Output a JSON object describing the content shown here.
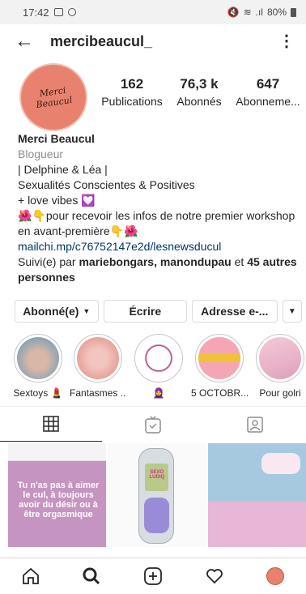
{
  "status_bar": {
    "time": "17:42",
    "battery": "80%"
  },
  "header": {
    "username": "mercibeaucul_"
  },
  "avatar": {
    "logo_text": "Merci Beaucul"
  },
  "stats": [
    {
      "value": "162",
      "label": "Publications"
    },
    {
      "value": "76,3 k",
      "label": "Abonnés"
    },
    {
      "value": "647",
      "label": "Abonneme..."
    }
  ],
  "bio": {
    "name": "Merci Beaucul",
    "category": "Blogueur",
    "line1": "| Delphine & Léa |",
    "line2": "Sexualités Conscientes & Positives",
    "line3": "+ love vibes",
    "line4": "pour recevoir les infos de notre premier workshop",
    "line5": "en avant-première",
    "link": "mailchi.mp/c76752147e2d/lesnewsducul",
    "followed_prefix": "Suivi(e) par",
    "followed_names": "mariebongars, manondupau",
    "followed_and": "et",
    "followed_others": "45 autres personnes"
  },
  "buttons": {
    "following": "Abonné(e)",
    "message": "Écrire",
    "address": "Adresse e-..."
  },
  "highlights": [
    {
      "label": "Sextoys 💄"
    },
    {
      "label": "Fantasmes ..."
    },
    {
      "label": "🧕"
    },
    {
      "label": "5 OCTOBR..."
    },
    {
      "label": "Pour golri"
    }
  ],
  "posts": {
    "post1_text": "Tu n'as pas à aimer le cul, à toujours avoir du désir ou à être orgasmique",
    "post2_screen_text": "SEXO LUDIQ"
  },
  "colors": {
    "accent_link": "#003569",
    "avatar_bg": "#e8826e",
    "muted_text": "#8e8e8e"
  }
}
